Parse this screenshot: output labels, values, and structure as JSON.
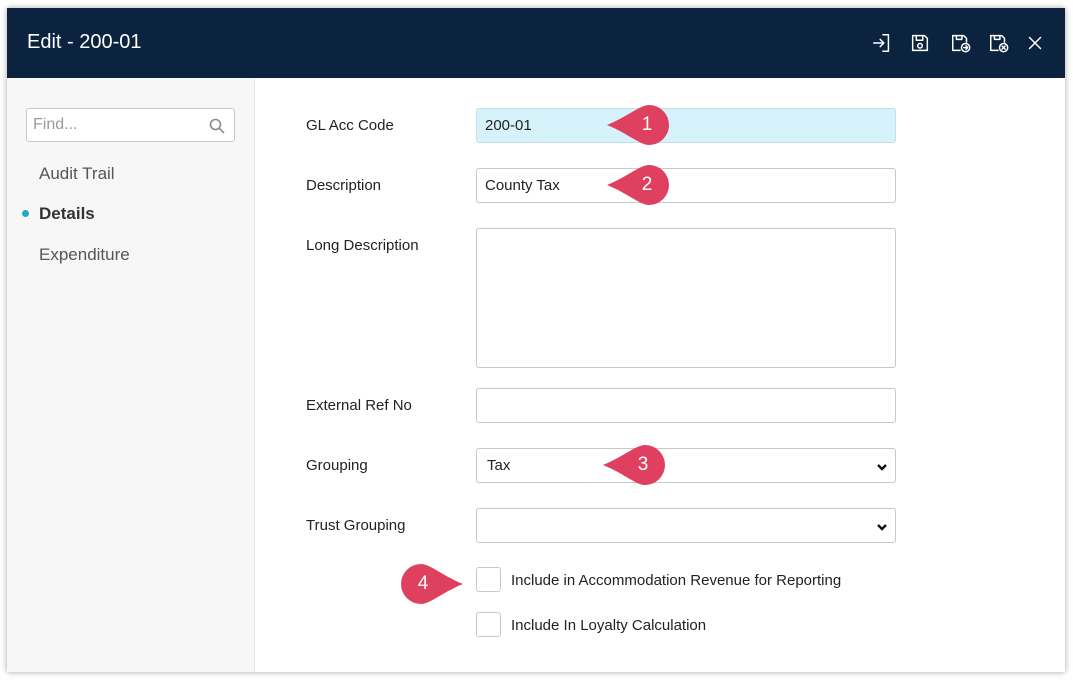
{
  "window": {
    "title": "Edit - 200-01"
  },
  "toolbar": {
    "icons": [
      "sign-in-icon",
      "save-icon",
      "save-and-new-icon",
      "save-and-close-icon",
      "close-icon"
    ]
  },
  "sidebar": {
    "find_placeholder": "Find...",
    "items": [
      {
        "label": "Audit Trail",
        "active": false
      },
      {
        "label": "Details",
        "active": true
      },
      {
        "label": "Expenditure",
        "active": false
      }
    ]
  },
  "form": {
    "gl_acc_code": {
      "label": "GL Acc Code",
      "value": "200-01"
    },
    "description": {
      "label": "Description",
      "value": "County Tax"
    },
    "long_description": {
      "label": "Long Description",
      "value": ""
    },
    "external_ref_no": {
      "label": "External Ref No",
      "value": ""
    },
    "grouping": {
      "label": "Grouping",
      "value": "Tax"
    },
    "trust_grouping": {
      "label": "Trust Grouping",
      "value": ""
    },
    "include_accommodation": {
      "label": "Include in Accommodation Revenue for Reporting",
      "checked": false
    },
    "include_loyalty": {
      "label": "Include In Loyalty Calculation",
      "checked": false
    }
  },
  "callouts": [
    "1",
    "2",
    "3",
    "4"
  ],
  "colors": {
    "titlebar": "#0c2340",
    "accent": "#25a8c5",
    "callout": "#e0405f",
    "code_field": "#d6f3fb"
  }
}
